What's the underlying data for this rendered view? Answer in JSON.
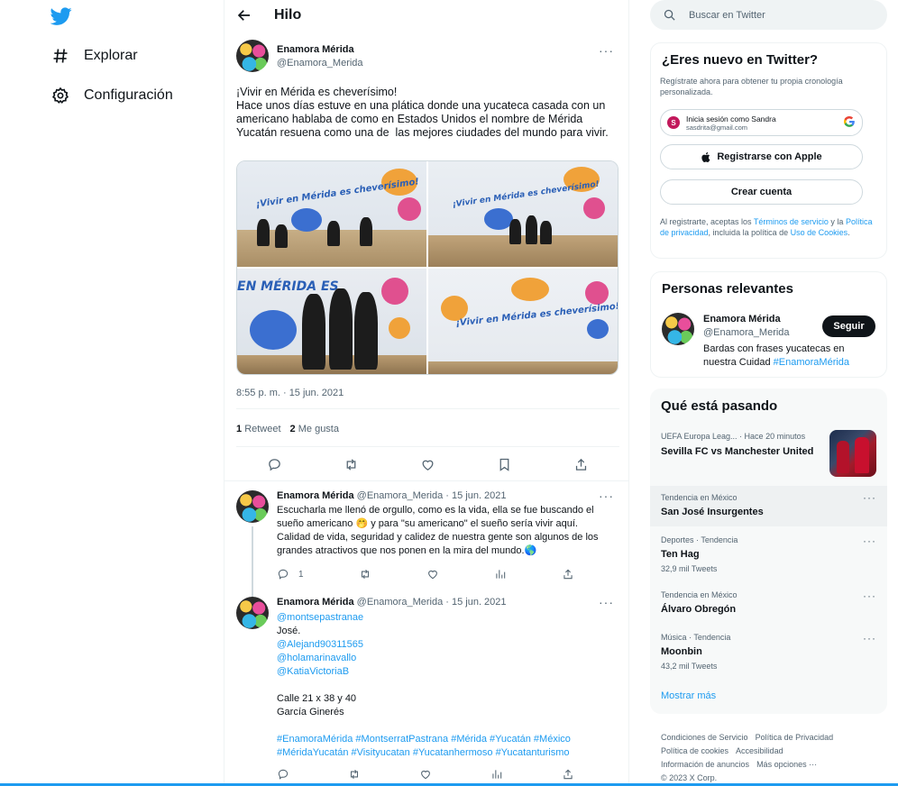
{
  "nav": {
    "items": [
      {
        "label": "Explorar",
        "icon": "hash-icon"
      },
      {
        "label": "Configuración",
        "icon": "gear-icon"
      }
    ]
  },
  "thread": {
    "header_title": "Hilo",
    "main": {
      "name": "Enamora Mérida",
      "handle": "@Enamora_Merida",
      "text": "¡Vivir en Mérida es cheverísimo!\nHace unos días estuve en una plática donde una yucateca casada con un americano hablaba de como en Estados Unidos el nombre de Mérida Yucatán resuena como una de  las mejores ciudades del mundo para vivir.",
      "mural_text_1": "¡Vivir en Mérida es cheverísimo!",
      "mural_text_2": "¡Vivir en Mérida es cheverísimo!",
      "mural_text_3": "EN MÉRIDA ES",
      "mural_text_4": "¡Vivir en Mérida es cheverísimo!",
      "timestamp": "8:55 p. m. · 15 jun. 2021",
      "retweets_count": "1",
      "retweets_label": "Retweet",
      "likes_count": "2",
      "likes_label": "Me gusta"
    },
    "reply1": {
      "name": "Enamora Mérida",
      "meta": "@Enamora_Merida · 15 jun. 2021",
      "text": "Escucharla me llenó de orgullo, como es la vida, ella se fue buscando el sueño americano 🤭 y para \"su americano\" el sueño sería vivir aquí.\nCalidad de vida, seguridad y calidez de nuestra gente son algunos de los grandes atractivos que nos ponen en la mira del mundo.🌎",
      "reply_count": "1"
    },
    "reply2": {
      "name": "Enamora Mérida",
      "meta": "@Enamora_Merida · 15 jun. 2021",
      "mention_top": "@montsepastranae",
      "line_jose": "José.",
      "mentions": "@Alejand90311565\n@holamarinavallo\n@KatiaVictoriaB",
      "address": "Calle 21 x 38 y 40\nGarcía Ginerés",
      "hashtags": "#EnamoraMérida #MontserratPastrana #Mérida #Yucatán #México\n#MéridaYucatán #Visityucatan #Yucatanhermoso #Yucatanturismo"
    }
  },
  "sidebar": {
    "search_placeholder": "Buscar en Twitter",
    "new": {
      "title": "¿Eres nuevo en Twitter?",
      "subtitle": "Regístrate ahora para obtener tu propia cronología personalizada.",
      "google_line1": "Inicia sesión como Sandra",
      "google_line2": "sasdrita@gmail.com",
      "apple_label": "Registrarse con Apple",
      "create_label": "Crear cuenta",
      "legal_1": "Al registrarte, aceptas los ",
      "terms": "Términos de servicio",
      "legal_2": " y la ",
      "privacy": "Política de privacidad",
      "legal_3": ", incluida la política de ",
      "cookies": "Uso de Cookies",
      "legal_4": "."
    },
    "relevant": {
      "title": "Personas relevantes",
      "name": "Enamora Mérida",
      "handle": "@Enamora_Merida",
      "follow_label": "Seguir",
      "bio": "Bardas con frases yucatecas en nuestra Cuidad ",
      "bio_tag": "#EnamoraMérida"
    },
    "trending": {
      "title": "Qué está pasando",
      "featured_meta": "UEFA Europa Leag... · Hace 20 minutos",
      "featured_title": "Sevilla FC vs Manchester United",
      "items": [
        {
          "category": "Tendencia en México",
          "name": "San José Insurgentes",
          "count": ""
        },
        {
          "category": "Deportes · Tendencia",
          "name": "Ten Hag",
          "count": "32,9 mil Tweets"
        },
        {
          "category": "Tendencia en México",
          "name": "Álvaro Obregón",
          "count": ""
        },
        {
          "category": "Música · Tendencia",
          "name": "Moonbin",
          "count": "43,2 mil Tweets"
        }
      ],
      "show_more": "Mostrar más"
    },
    "footer": {
      "terms": "Condiciones de Servicio",
      "privacy": "Política de Privacidad",
      "cookies": "Política de cookies",
      "accessibility": "Accesibilidad",
      "ads": "Información de anuncios",
      "more": "Más opciones ···",
      "copyright": "© 2023 X Corp."
    }
  },
  "colors": {
    "accent": "#1d9bf0",
    "text": "#0f1419",
    "muted": "#536471",
    "hover": "#f7f9f9"
  }
}
